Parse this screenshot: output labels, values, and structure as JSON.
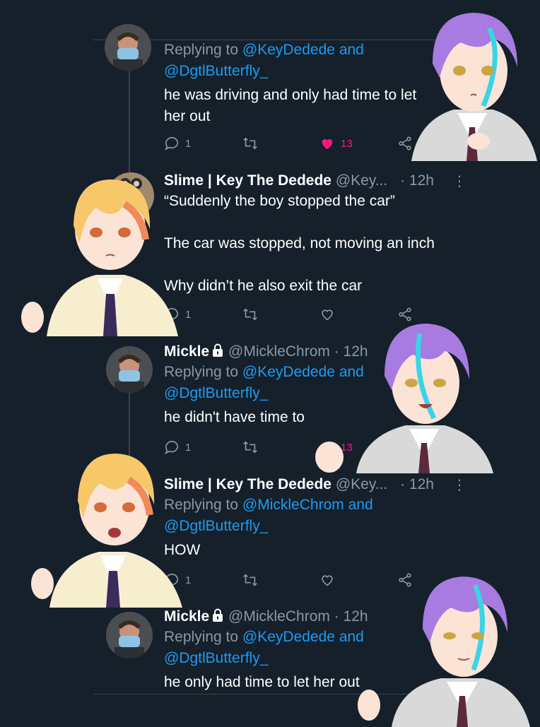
{
  "tweets": [
    {
      "reply_prefix": "Replying to ",
      "reply_user1": "@KeyDedede",
      "reply_and": " and",
      "reply_user2": "@DgtlButterfly_",
      "text": "he was driving and only had time to let\nher out",
      "replies": "1",
      "likes": "13"
    },
    {
      "name": "Slime | Key The Dedede",
      "handle": "@Key...",
      "time": "· 12h",
      "text": "“Suddenly the boy stopped the car”\n\nThe car was stopped, not moving an inch\n\nWhy didn’t he also exit the car",
      "replies": "1"
    },
    {
      "name": "Mickle",
      "handle": "@MickleChrom",
      "time": "· 12h",
      "reply_prefix": "Replying to ",
      "reply_user1": "@KeyDedede",
      "reply_and": " and",
      "reply_user2": "@DgtlButterfly_",
      "text": "he didn't have time to",
      "replies": "1",
      "likes": "13"
    },
    {
      "name": "Slime | Key The Dedede",
      "handle": "@Key...",
      "time": "· 12h",
      "reply_prefix": "Replying to ",
      "reply_user1": "@MickleChrom",
      "reply_and": " and",
      "reply_user2": "@DgtlButterfly_",
      "text": "HOW",
      "replies": "1"
    },
    {
      "name": "Mickle",
      "handle": "@MickleChrom",
      "time": "· 12h",
      "reply_prefix": "Replying to ",
      "reply_user1": "@KeyDedede",
      "reply_and": " and",
      "reply_user2": "@DgtlButterfly_",
      "text": "he only had time to let her out"
    }
  ],
  "colors": {
    "background": "#15202b",
    "link": "#1d9bf0",
    "muted": "#8899a6",
    "like": "#f91880"
  },
  "icons": [
    "reply-icon",
    "retweet-icon",
    "like-icon",
    "share-icon",
    "more-icon",
    "lock-icon"
  ]
}
